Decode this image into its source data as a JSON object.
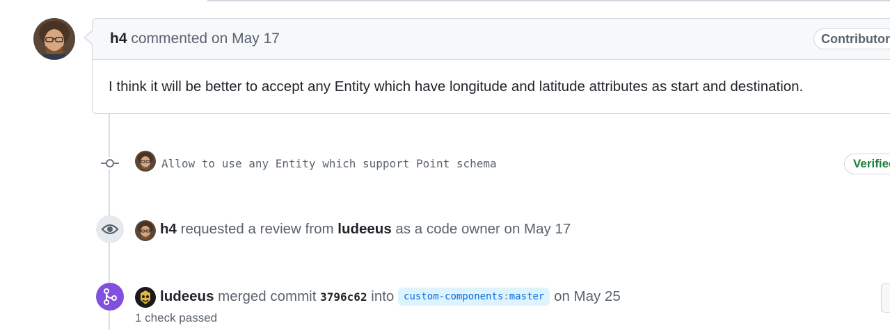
{
  "comment": {
    "author": "h4",
    "action": "commented on May 17",
    "badge": "Contributor",
    "body": "I think it will be better to accept any Entity which have longitude and latitude attributes as start and destination."
  },
  "commit": {
    "message": "Allow to use any Entity which support Point schema",
    "verified": "Verified"
  },
  "review_event": {
    "actor": "h4",
    "text1": "requested a review from",
    "reviewer": "ludeeus",
    "text2": "as a code owner on May 17"
  },
  "merge_event": {
    "actor": "ludeeus",
    "text1": "merged commit",
    "sha": "3796c62",
    "text2": "into",
    "branch_repo": "custom-components",
    "branch_sep": ":",
    "branch_name": "master",
    "text3": "on May 25",
    "checks": "1 check passed"
  },
  "icons": {
    "review": "eye-icon",
    "commit": "git-commit-icon",
    "merge": "git-merge-icon"
  },
  "colors": {
    "merge_purple": "#8250df",
    "verified_green": "#1a7f37",
    "link_blue": "#0969da"
  }
}
